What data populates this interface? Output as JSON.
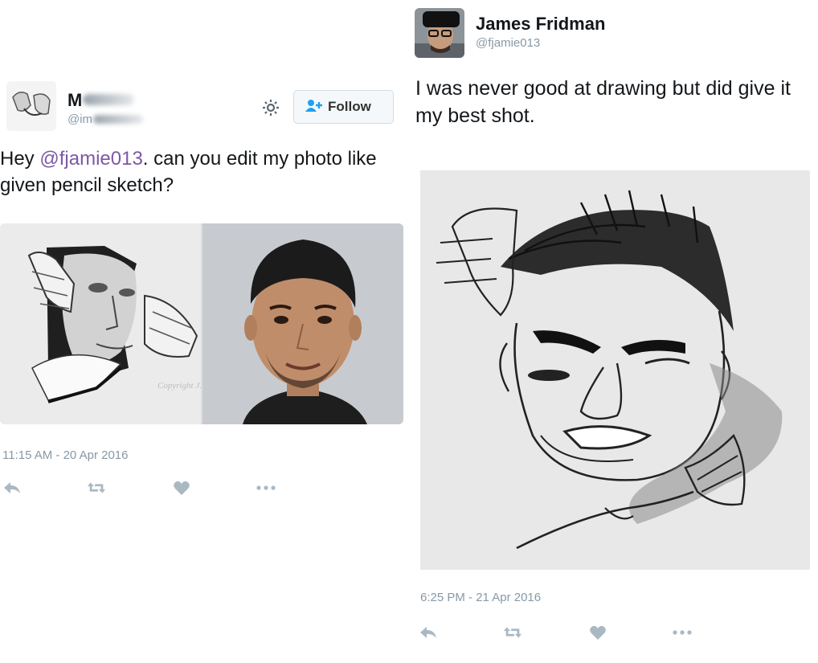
{
  "left_tweet": {
    "name_partial": "M",
    "handle_partial": "@im",
    "follow_label": "Follow",
    "text_pre": "Hey ",
    "mention": "@fjamie013",
    "text_post": ". can you edit my photo like given pencil sketch?",
    "media_watermark": "Copyright J.D. Hill",
    "timestamp": "11:15 AM - 20 Apr 2016"
  },
  "right_tweet": {
    "name": "James Fridman",
    "handle": "@fjamie013",
    "text": "I was never good at drawing but did give it my best shot.",
    "timestamp": "6:25 PM - 21 Apr 2016"
  },
  "colors": {
    "mention": "#7e57a5",
    "action_icon": "#aab8c2",
    "follow_icon": "#1da1f2"
  },
  "icons": [
    "gear-icon",
    "follow-person-icon",
    "reply-icon",
    "retweet-icon",
    "like-icon",
    "more-icon"
  ]
}
